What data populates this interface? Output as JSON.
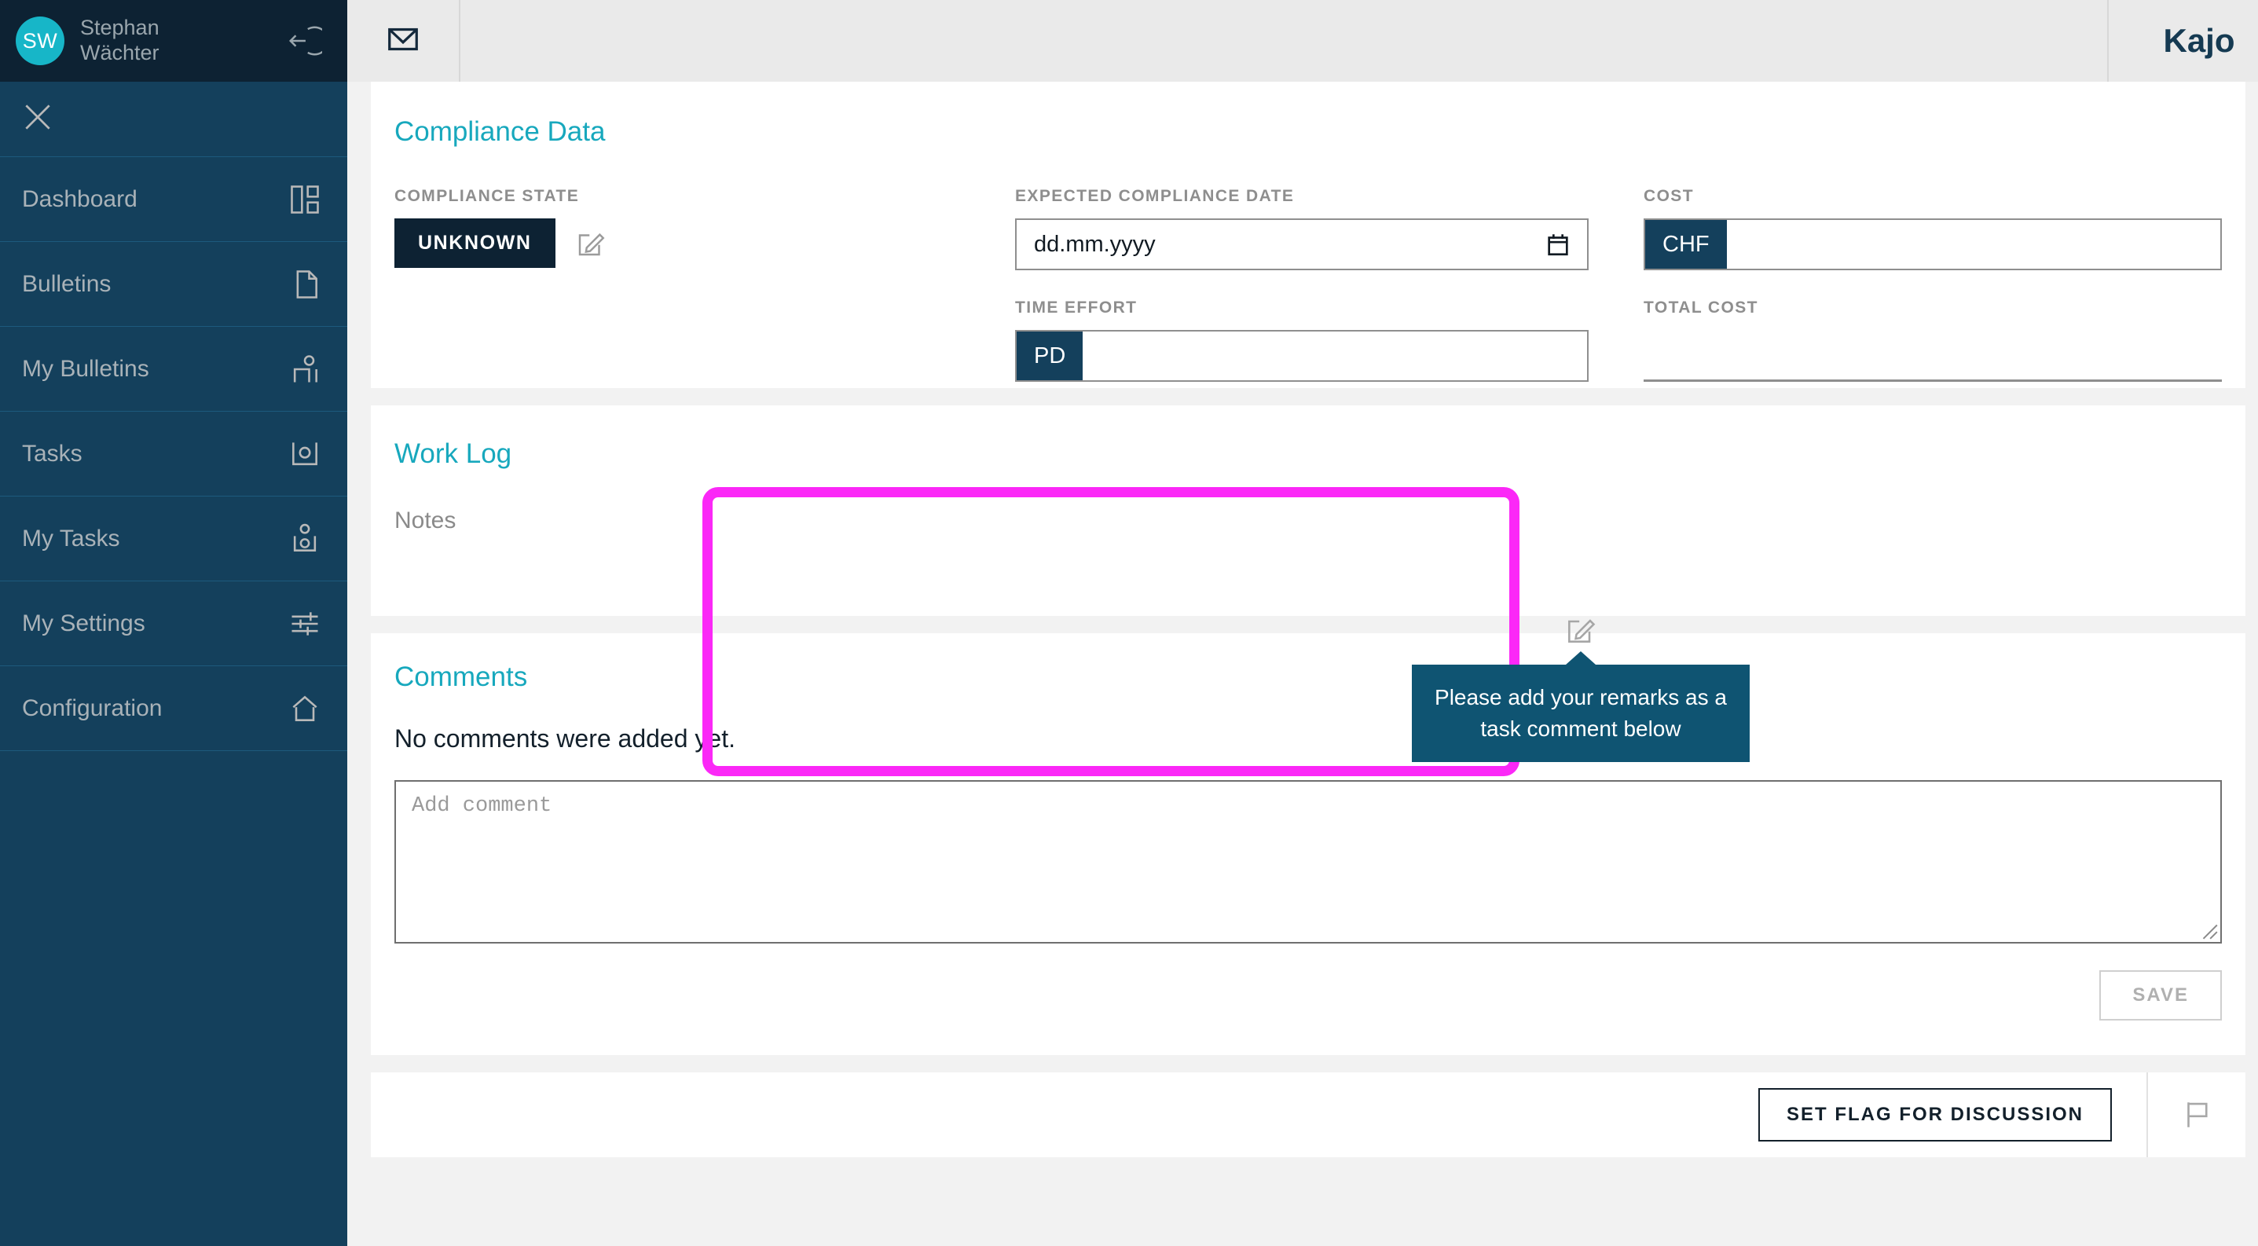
{
  "sidebar": {
    "user": {
      "initials": "SW",
      "name": "Stephan Wächter"
    },
    "logout_icon": "logout-arrow-icon",
    "close_icon": "close-icon",
    "items": [
      {
        "label": "Dashboard",
        "icon": "dashboard-icon"
      },
      {
        "label": "Bulletins",
        "icon": "document-icon"
      },
      {
        "label": "My Bulletins",
        "icon": "person-document-icon"
      },
      {
        "label": "Tasks",
        "icon": "task-tray-icon"
      },
      {
        "label": "My Tasks",
        "icon": "person-task-tray-icon"
      },
      {
        "label": "My Settings",
        "icon": "sliders-icon"
      },
      {
        "label": "Configuration",
        "icon": "home-icon"
      }
    ]
  },
  "topbar": {
    "mail_icon": "envelope-icon",
    "brand": "Kajo"
  },
  "compliance": {
    "title": "Compliance Data",
    "state_label": "COMPLIANCE STATE",
    "state_value": "UNKNOWN",
    "state_edit_icon": "edit-pencil-icon",
    "date_label": "EXPECTED COMPLIANCE DATE",
    "date_placeholder": "dd.mm.yyyy",
    "date_icon": "calendar-icon",
    "time_effort_label": "TIME EFFORT",
    "time_effort_unit": "PD",
    "time_effort_value": "",
    "cost_label": "COST",
    "cost_currency": "CHF",
    "cost_value": "",
    "total_cost_label": "TOTAL COST",
    "total_cost_value": ""
  },
  "worklog": {
    "title": "Work Log",
    "notes_label": "Notes",
    "edit_icon": "edit-pencil-icon"
  },
  "tooltip": {
    "text": "Please add your remarks as a task comment below"
  },
  "comments": {
    "title": "Comments",
    "empty_text": "No comments were added yet.",
    "input_placeholder": "Add comment",
    "input_value": "",
    "save_label": "SAVE"
  },
  "actions": {
    "flag_label": "SET FLAG FOR DISCUSSION",
    "flag_icon": "flag-outline-icon"
  },
  "colors": {
    "sidebar": "#14405c",
    "sidebar_dark": "#0d2233",
    "accent_teal": "#17a8bd",
    "avatar": "#17b6c8",
    "highlight": "#fb28f7",
    "tooltip": "#0f5472",
    "brand": "#153a52"
  }
}
